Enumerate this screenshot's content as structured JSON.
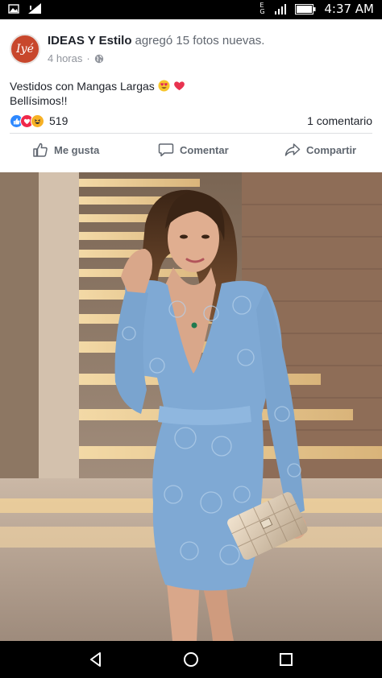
{
  "status_bar": {
    "time": "4:37 AM",
    "network": "E G",
    "icons": [
      "image-notification-icon",
      "signal-icon",
      "battery-icon"
    ]
  },
  "post": {
    "avatar_text": "Iyé",
    "page_name": "IDEAS Y Estilo",
    "action_text": "agregó 15 fotos nuevas.",
    "time_ago": "4 horas",
    "separator": "·",
    "privacy_icon": "globe-icon",
    "text_line1": "Vestidos con Mangas Largas",
    "text_line2": "Bellísimos!!",
    "text_emojis": [
      "heart-eyes-emoji",
      "red-heart-emoji"
    ],
    "reaction_types": [
      "like",
      "love",
      "haha"
    ],
    "reaction_count": "519",
    "comment_count": "1 comentario"
  },
  "actions": {
    "like_label": "Me gusta",
    "comment_label": "Comentar",
    "share_label": "Compartir"
  },
  "photo": {
    "subject": "woman in light blue lace long-sleeve dress holding gold quilted clutch"
  },
  "colors": {
    "brand_avatar": "#c8472c",
    "like_blue": "#2d88ff",
    "love_red": "#f0284a",
    "haha_yellow": "#f7b125",
    "text_primary": "#1d2129",
    "text_secondary": "#90949c",
    "dress_blue": "#7fa9d4"
  },
  "nav": {
    "buttons": [
      "back-icon",
      "home-icon",
      "recents-icon"
    ]
  }
}
